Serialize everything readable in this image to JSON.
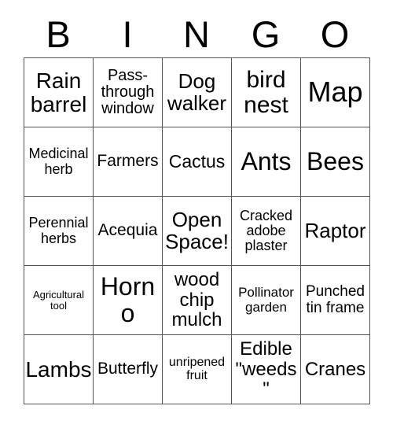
{
  "card": {
    "title_letters": [
      "B",
      "I",
      "N",
      "G",
      "O"
    ],
    "columns": 5,
    "rows": 5,
    "colors": {
      "background": "#ffffff",
      "text": "#000000",
      "grid_line": "#555555"
    },
    "cells": [
      {
        "text": "Rain barrel",
        "size": "fs-28",
        "row": 1,
        "col": 1
      },
      {
        "text": "Pass-through window",
        "size": "fs-20",
        "row": 1,
        "col": 2
      },
      {
        "text": "Dog walker",
        "size": "fs-26",
        "row": 1,
        "col": 3
      },
      {
        "text": "bird nest",
        "size": "fs-30",
        "row": 1,
        "col": 4
      },
      {
        "text": "Map",
        "size": "fs-36",
        "row": 1,
        "col": 5
      },
      {
        "text": "Medicinal herb",
        "size": "fs-18",
        "row": 2,
        "col": 1
      },
      {
        "text": "Farmers",
        "size": "fs-21",
        "row": 2,
        "col": 2
      },
      {
        "text": "Cactus",
        "size": "fs-23",
        "row": 2,
        "col": 3
      },
      {
        "text": "Ants",
        "size": "fs-32",
        "row": 2,
        "col": 4
      },
      {
        "text": "Bees",
        "size": "fs-32",
        "row": 2,
        "col": 5
      },
      {
        "text": "Perennial herbs",
        "size": "fs-18",
        "row": 3,
        "col": 1
      },
      {
        "text": "Acequia",
        "size": "fs-21",
        "row": 3,
        "col": 2
      },
      {
        "text": "Open Space!",
        "size": "fs-26",
        "row": 3,
        "col": 3
      },
      {
        "text": "Cracked adobe plaster",
        "size": "fs-18",
        "row": 3,
        "col": 4
      },
      {
        "text": "Raptor",
        "size": "fs-26",
        "row": 3,
        "col": 5
      },
      {
        "text": "Agricultural tool",
        "size": "fs-13",
        "row": 4,
        "col": 1
      },
      {
        "text": "Horno",
        "size": "fs-32",
        "row": 4,
        "col": 2
      },
      {
        "text": "wood chip mulch",
        "size": "fs-24",
        "row": 4,
        "col": 3
      },
      {
        "text": "Pollinator garden",
        "size": "fs-17",
        "row": 4,
        "col": 4
      },
      {
        "text": "Punched tin frame",
        "size": "fs-19",
        "row": 4,
        "col": 5
      },
      {
        "text": "Lambs",
        "size": "fs-28",
        "row": 5,
        "col": 1
      },
      {
        "text": "Butterfly",
        "size": "fs-21",
        "row": 5,
        "col": 2
      },
      {
        "text": "unripened fruit",
        "size": "fs-16",
        "row": 5,
        "col": 3
      },
      {
        "text": "Edible \"weeds\"",
        "size": "fs-24",
        "row": 5,
        "col": 4
      },
      {
        "text": "Cranes",
        "size": "fs-24",
        "row": 5,
        "col": 5
      }
    ]
  }
}
